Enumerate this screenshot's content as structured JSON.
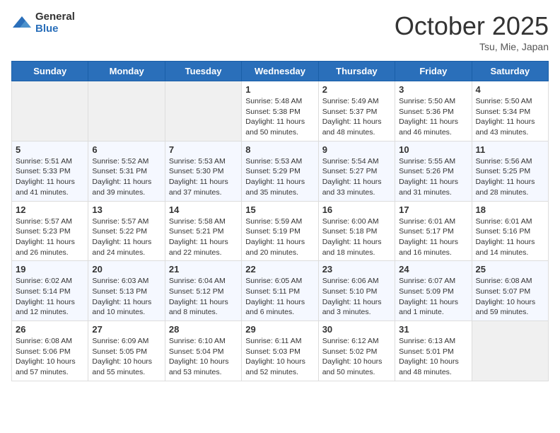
{
  "logo": {
    "general": "General",
    "blue": "Blue"
  },
  "header": {
    "month": "October 2025",
    "location": "Tsu, Mie, Japan"
  },
  "days_of_week": [
    "Sunday",
    "Monday",
    "Tuesday",
    "Wednesday",
    "Thursday",
    "Friday",
    "Saturday"
  ],
  "weeks": [
    [
      {
        "day": "",
        "info": ""
      },
      {
        "day": "",
        "info": ""
      },
      {
        "day": "",
        "info": ""
      },
      {
        "day": "1",
        "info": "Sunrise: 5:48 AM\nSunset: 5:38 PM\nDaylight: 11 hours\nand 50 minutes."
      },
      {
        "day": "2",
        "info": "Sunrise: 5:49 AM\nSunset: 5:37 PM\nDaylight: 11 hours\nand 48 minutes."
      },
      {
        "day": "3",
        "info": "Sunrise: 5:50 AM\nSunset: 5:36 PM\nDaylight: 11 hours\nand 46 minutes."
      },
      {
        "day": "4",
        "info": "Sunrise: 5:50 AM\nSunset: 5:34 PM\nDaylight: 11 hours\nand 43 minutes."
      }
    ],
    [
      {
        "day": "5",
        "info": "Sunrise: 5:51 AM\nSunset: 5:33 PM\nDaylight: 11 hours\nand 41 minutes."
      },
      {
        "day": "6",
        "info": "Sunrise: 5:52 AM\nSunset: 5:31 PM\nDaylight: 11 hours\nand 39 minutes."
      },
      {
        "day": "7",
        "info": "Sunrise: 5:53 AM\nSunset: 5:30 PM\nDaylight: 11 hours\nand 37 minutes."
      },
      {
        "day": "8",
        "info": "Sunrise: 5:53 AM\nSunset: 5:29 PM\nDaylight: 11 hours\nand 35 minutes."
      },
      {
        "day": "9",
        "info": "Sunrise: 5:54 AM\nSunset: 5:27 PM\nDaylight: 11 hours\nand 33 minutes."
      },
      {
        "day": "10",
        "info": "Sunrise: 5:55 AM\nSunset: 5:26 PM\nDaylight: 11 hours\nand 31 minutes."
      },
      {
        "day": "11",
        "info": "Sunrise: 5:56 AM\nSunset: 5:25 PM\nDaylight: 11 hours\nand 28 minutes."
      }
    ],
    [
      {
        "day": "12",
        "info": "Sunrise: 5:57 AM\nSunset: 5:23 PM\nDaylight: 11 hours\nand 26 minutes."
      },
      {
        "day": "13",
        "info": "Sunrise: 5:57 AM\nSunset: 5:22 PM\nDaylight: 11 hours\nand 24 minutes."
      },
      {
        "day": "14",
        "info": "Sunrise: 5:58 AM\nSunset: 5:21 PM\nDaylight: 11 hours\nand 22 minutes."
      },
      {
        "day": "15",
        "info": "Sunrise: 5:59 AM\nSunset: 5:19 PM\nDaylight: 11 hours\nand 20 minutes."
      },
      {
        "day": "16",
        "info": "Sunrise: 6:00 AM\nSunset: 5:18 PM\nDaylight: 11 hours\nand 18 minutes."
      },
      {
        "day": "17",
        "info": "Sunrise: 6:01 AM\nSunset: 5:17 PM\nDaylight: 11 hours\nand 16 minutes."
      },
      {
        "day": "18",
        "info": "Sunrise: 6:01 AM\nSunset: 5:16 PM\nDaylight: 11 hours\nand 14 minutes."
      }
    ],
    [
      {
        "day": "19",
        "info": "Sunrise: 6:02 AM\nSunset: 5:14 PM\nDaylight: 11 hours\nand 12 minutes."
      },
      {
        "day": "20",
        "info": "Sunrise: 6:03 AM\nSunset: 5:13 PM\nDaylight: 11 hours\nand 10 minutes."
      },
      {
        "day": "21",
        "info": "Sunrise: 6:04 AM\nSunset: 5:12 PM\nDaylight: 11 hours\nand 8 minutes."
      },
      {
        "day": "22",
        "info": "Sunrise: 6:05 AM\nSunset: 5:11 PM\nDaylight: 11 hours\nand 6 minutes."
      },
      {
        "day": "23",
        "info": "Sunrise: 6:06 AM\nSunset: 5:10 PM\nDaylight: 11 hours\nand 3 minutes."
      },
      {
        "day": "24",
        "info": "Sunrise: 6:07 AM\nSunset: 5:09 PM\nDaylight: 11 hours\nand 1 minute."
      },
      {
        "day": "25",
        "info": "Sunrise: 6:08 AM\nSunset: 5:07 PM\nDaylight: 10 hours\nand 59 minutes."
      }
    ],
    [
      {
        "day": "26",
        "info": "Sunrise: 6:08 AM\nSunset: 5:06 PM\nDaylight: 10 hours\nand 57 minutes."
      },
      {
        "day": "27",
        "info": "Sunrise: 6:09 AM\nSunset: 5:05 PM\nDaylight: 10 hours\nand 55 minutes."
      },
      {
        "day": "28",
        "info": "Sunrise: 6:10 AM\nSunset: 5:04 PM\nDaylight: 10 hours\nand 53 minutes."
      },
      {
        "day": "29",
        "info": "Sunrise: 6:11 AM\nSunset: 5:03 PM\nDaylight: 10 hours\nand 52 minutes."
      },
      {
        "day": "30",
        "info": "Sunrise: 6:12 AM\nSunset: 5:02 PM\nDaylight: 10 hours\nand 50 minutes."
      },
      {
        "day": "31",
        "info": "Sunrise: 6:13 AM\nSunset: 5:01 PM\nDaylight: 10 hours\nand 48 minutes."
      },
      {
        "day": "",
        "info": ""
      }
    ]
  ]
}
